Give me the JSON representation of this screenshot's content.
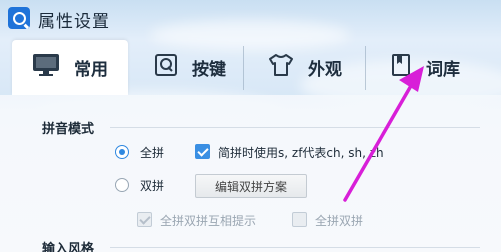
{
  "window": {
    "title": "属性设置"
  },
  "tabs": [
    {
      "label": "常用",
      "icon": "monitor-icon",
      "active": true
    },
    {
      "label": "按键",
      "icon": "keyboard-q-icon",
      "active": false
    },
    {
      "label": "外观",
      "icon": "tshirt-icon",
      "active": false
    },
    {
      "label": "词库",
      "icon": "book-icon",
      "active": false
    }
  ],
  "pinyin_mode": {
    "title": "拼音模式",
    "full_pinyin": {
      "label": "全拼",
      "checked": true
    },
    "jianpin": {
      "label": "简拼时使用",
      "text": "s, zf代表ch, sh, zh",
      "checked": true
    },
    "double_pinyin": {
      "label": "双拼",
      "checked": false
    },
    "edit_scheme_button": "编辑双拼方案",
    "mutual_hint": {
      "label": "全拼双拼互相提示",
      "checked": true,
      "disabled": true
    },
    "double_other": {
      "label": "全拼双拼",
      "checked": false,
      "disabled": true
    }
  },
  "input_style": {
    "title": "输入风格"
  },
  "colors": {
    "accent": "#2f88e0",
    "annotation_arrow": "#d81fd8"
  }
}
